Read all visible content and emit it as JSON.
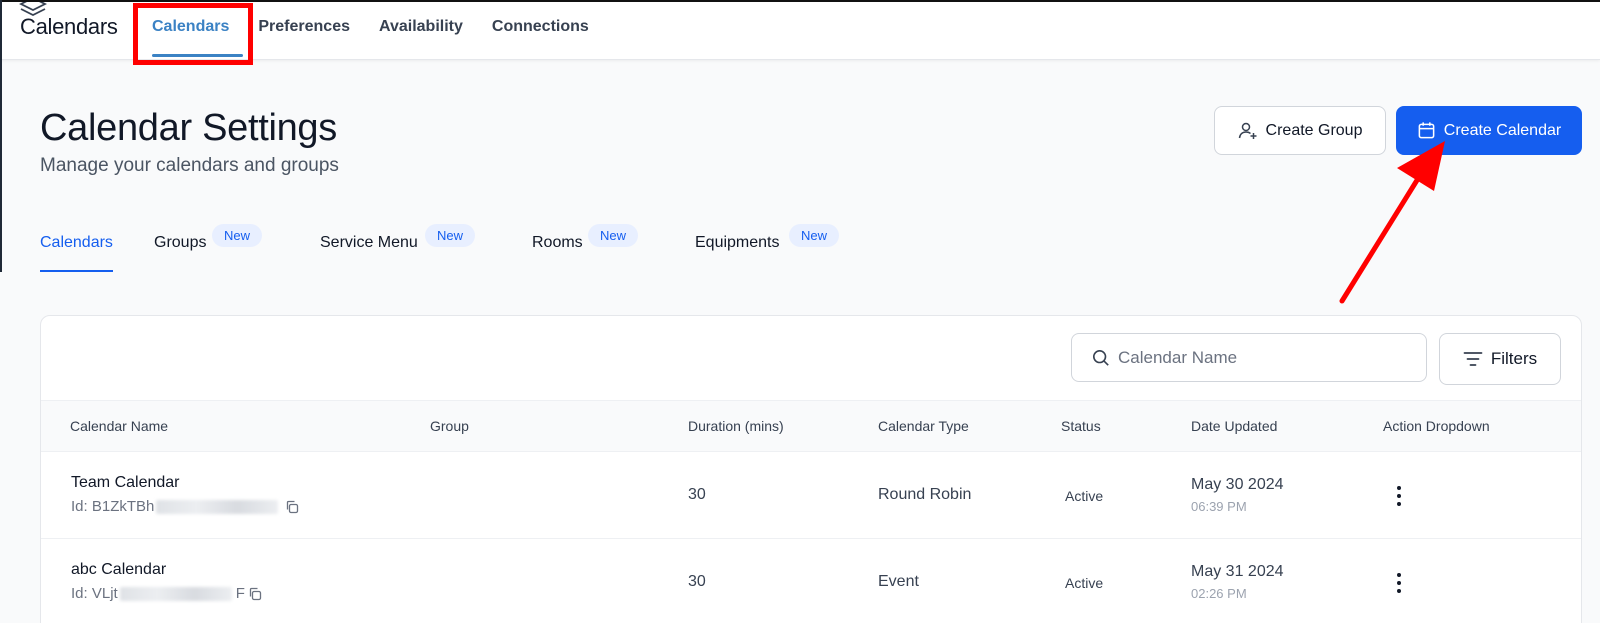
{
  "app": {
    "title": "Calendars"
  },
  "topnav": {
    "items": [
      "Calendars",
      "Preferences",
      "Availability",
      "Connections"
    ],
    "active_index": 0
  },
  "page": {
    "title": "Calendar Settings",
    "subtitle": "Manage your calendars and groups"
  },
  "actions": {
    "create_group": "Create Group",
    "create_calendar": "Create Calendar"
  },
  "subtabs": [
    {
      "label": "Calendars",
      "badge": ""
    },
    {
      "label": "Groups",
      "badge": "New"
    },
    {
      "label": "Service Menu",
      "badge": "New"
    },
    {
      "label": "Rooms",
      "badge": "New"
    },
    {
      "label": "Equipments",
      "badge": "New"
    }
  ],
  "search": {
    "placeholder": "Calendar Name"
  },
  "filters": {
    "label": "Filters"
  },
  "table": {
    "columns": [
      "Calendar Name",
      "Group",
      "Duration (mins)",
      "Calendar Type",
      "Status",
      "Date Updated",
      "Action Dropdown"
    ],
    "rows": [
      {
        "name": "Team Calendar",
        "id_prefix": "Id: B1ZkTBh",
        "id_suffix": "",
        "group": "",
        "duration": "30",
        "type": "Round Robin",
        "status": "Active",
        "date": "May 30 2024",
        "time": "06:39 PM"
      },
      {
        "name": "abc Calendar",
        "id_prefix": "Id: VLjt",
        "id_suffix": "F",
        "group": "",
        "duration": "30",
        "type": "Event",
        "status": "Active",
        "date": "May 31 2024",
        "time": "02:26 PM"
      }
    ]
  },
  "colors": {
    "accent": "#155eef",
    "topnav_active": "#3b82c4",
    "annotation": "#ff0000"
  },
  "icons": [
    "calendar-logo-icon",
    "user-plus-icon",
    "calendar-icon",
    "search-icon",
    "filter-icon",
    "copy-icon",
    "more-vertical-icon"
  ]
}
